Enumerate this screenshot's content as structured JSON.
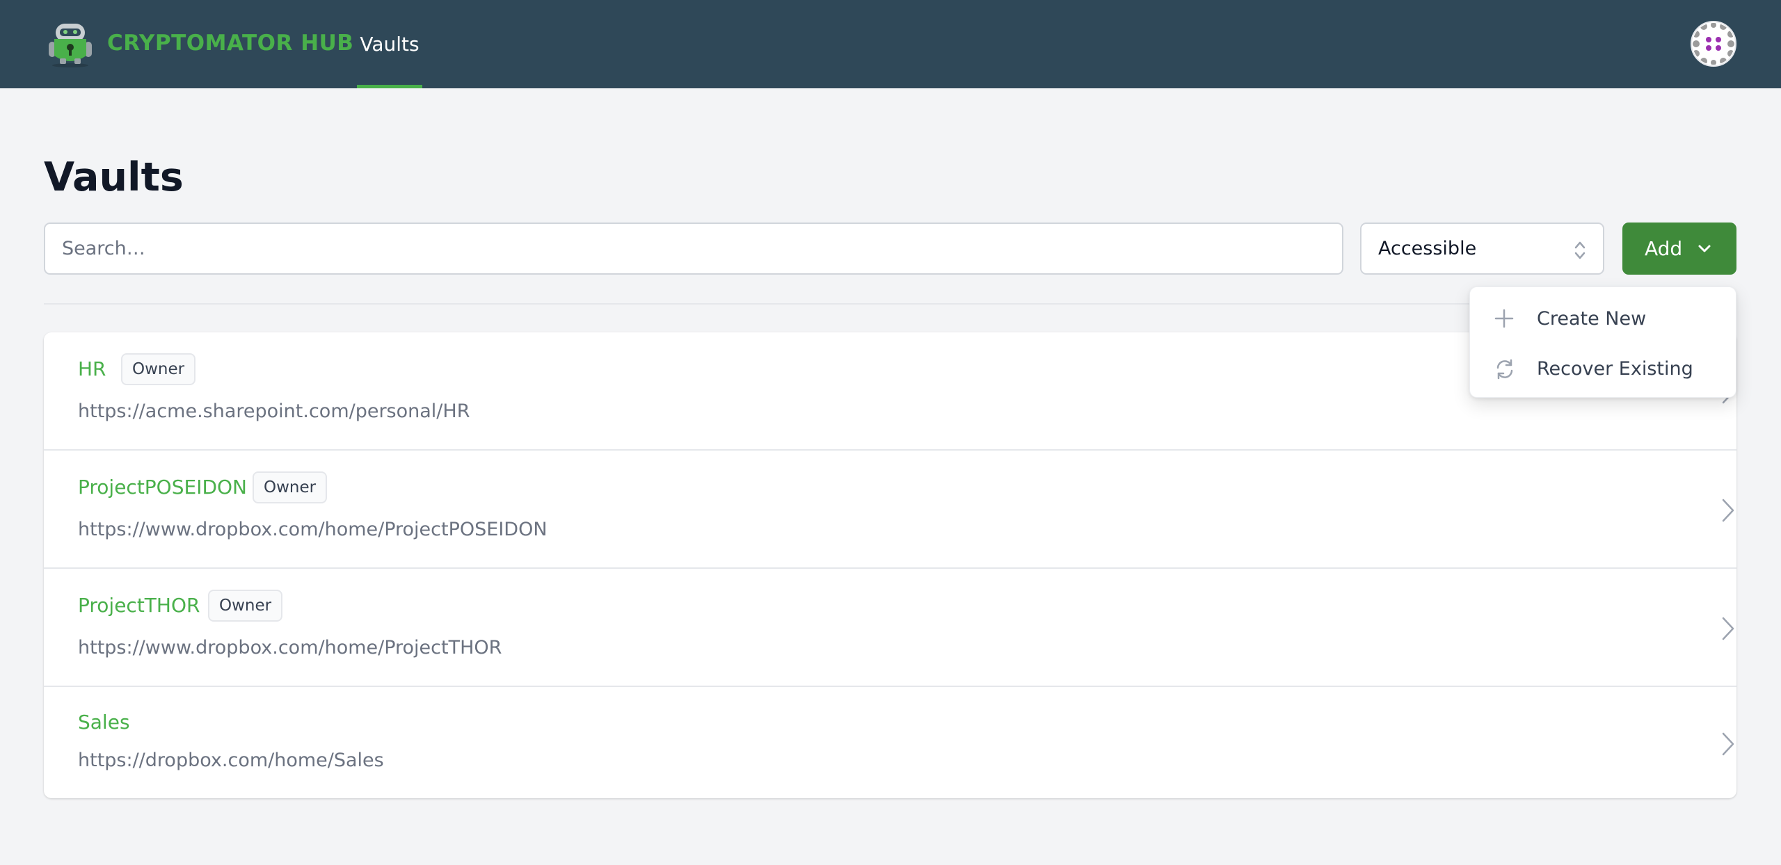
{
  "header": {
    "brand": "CRYPTOMATOR HUB",
    "nav_tab": "Vaults",
    "logo_icon": "cryptomator-robot-logo",
    "avatar_icon": "identicon-avatar",
    "brand_color": "#49b04a",
    "bar_color": "#2f4858"
  },
  "main": {
    "title": "Vaults",
    "search_placeholder": "Search…",
    "filter_value": "Accessible",
    "add_label": "Add"
  },
  "dropdown": {
    "items": [
      {
        "label": "Create New",
        "icon": "plus-icon"
      },
      {
        "label": "Recover Existing",
        "icon": "refresh-icon"
      }
    ]
  },
  "vaults": [
    {
      "name": "HR",
      "badge": "Owner",
      "url": "https://acme.sharepoint.com/personal/HR"
    },
    {
      "name": "ProjectPOSEIDON",
      "badge": "Owner",
      "url": "https://www.dropbox.com/home/ProjectPOSEIDON"
    },
    {
      "name": "ProjectTHOR",
      "badge": "Owner",
      "url": "https://www.dropbox.com/home/ProjectTHOR"
    },
    {
      "name": "Sales",
      "url": "https://dropbox.com/home/Sales"
    }
  ],
  "colors": {
    "accent_green": "#49b04a",
    "button_green": "#3f8a3a",
    "background": "#f3f4f6"
  }
}
